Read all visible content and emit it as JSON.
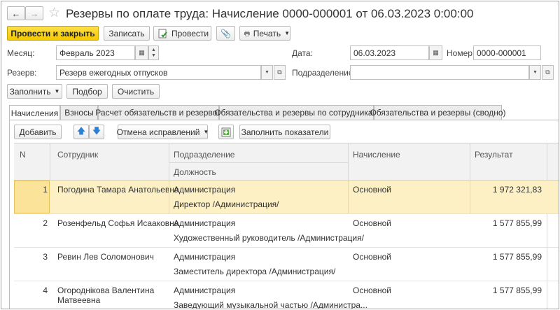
{
  "window": {
    "title": "Резервы по оплате труда: Начисление 0000-000001 от 06.03.2023 0:00:00"
  },
  "toolbar": {
    "post_close": "Провести и закрыть",
    "save": "Записать",
    "post": "Провести",
    "print": "Печать"
  },
  "form": {
    "month_label": "Месяц:",
    "month_value": "Февраль 2023",
    "date_label": "Дата:",
    "date_value": "06.03.2023",
    "number_label": "Номер:",
    "number_value": "0000-000001",
    "reserve_label": "Резерв:",
    "reserve_value": "Резерв ежегодных отпусков",
    "department_label": "Подразделение:",
    "department_value": ""
  },
  "actions": {
    "fill": "Заполнить",
    "select": "Подбор",
    "clear": "Очистить"
  },
  "tabs": [
    {
      "label": "Начисления"
    },
    {
      "label": "Взносы"
    },
    {
      "label": "Расчет обязательств и резервов"
    },
    {
      "label": "Обязательства и резервы по сотрудникам"
    },
    {
      "label": "Обязательства и резервы (сводно)"
    }
  ],
  "table_toolbar": {
    "add": "Добавить",
    "cancel_fixes": "Отмена исправлений",
    "fill_indicators": "Заполнить показатели"
  },
  "table": {
    "headers": {
      "n": "N",
      "employee": "Сотрудник",
      "department": "Подразделение",
      "position": "Должность",
      "accrual": "Начисление",
      "result": "Результат"
    },
    "rows": [
      {
        "n": "1",
        "employee": "Погодина Тамара Анатольевна",
        "employee2": "",
        "department": "Администрация",
        "position": "Директор /Администрация/",
        "accrual": "Основной",
        "result": "1 972 321,83"
      },
      {
        "n": "2",
        "employee": "Розенфельд Софья Исааковна",
        "employee2": "",
        "department": "Администрация",
        "position": "Художественный руководитель /Администрация/",
        "accrual": "Основной",
        "result": "1 577 855,99"
      },
      {
        "n": "3",
        "employee": "Ревин Лев Соломонович",
        "employee2": "",
        "department": "Администрация",
        "position": "Заместитель директора /Администрация/",
        "accrual": "Основной",
        "result": "1 577 855,99"
      },
      {
        "n": "4",
        "employee": "Огороднікова Валентина",
        "employee2": "Матвеевна",
        "department": "Администрация",
        "position": "Заведующий музыкальной частью /Администра...",
        "accrual": "Основной",
        "result": "1 577 855,99"
      }
    ]
  },
  "icons": [
    "back-arrow-icon",
    "forward-arrow-icon",
    "star-icon",
    "clip-icon",
    "printer-icon",
    "calendar-icon",
    "up-arrow-icon",
    "down-arrow-icon",
    "post-doc-icon",
    "fill-indicators-icon"
  ]
}
